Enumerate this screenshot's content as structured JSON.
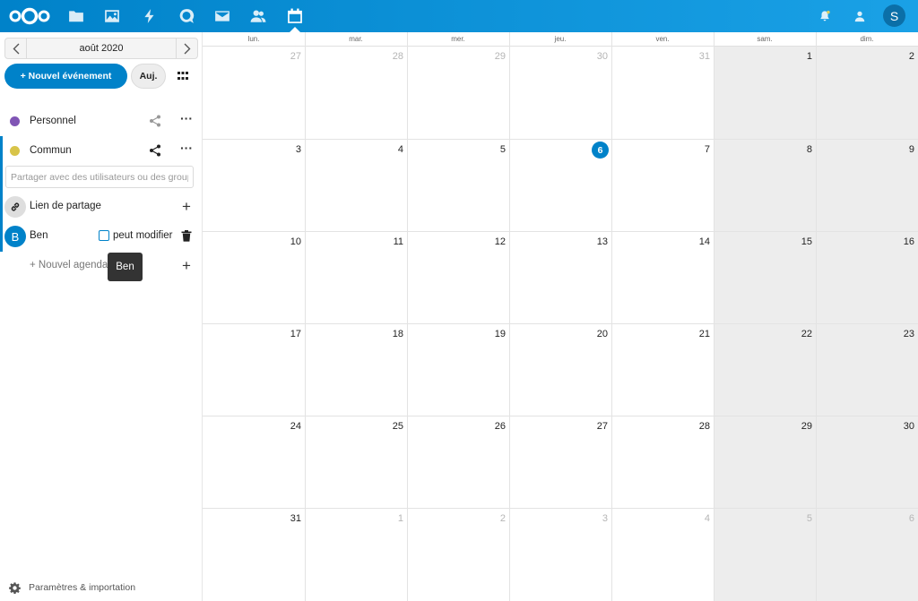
{
  "header": {
    "apps": [
      {
        "name": "files-icon"
      },
      {
        "name": "photos-icon"
      },
      {
        "name": "activity-icon"
      },
      {
        "name": "talk-icon"
      },
      {
        "name": "mail-icon"
      },
      {
        "name": "contacts-icon"
      },
      {
        "name": "calendar-icon",
        "active": true
      }
    ],
    "avatar_initial": "S"
  },
  "sidebar": {
    "month_label": "août 2020",
    "new_event_label": "+ Nouvel événement",
    "today_label": "Auj.",
    "calendars": [
      {
        "name": "Personnel",
        "color": "#8055b5"
      },
      {
        "name": "Commun",
        "color": "#d8c449"
      }
    ],
    "share_placeholder": "Partager avec des utilisateurs ou des groupes",
    "share_link_label": "Lien de partage",
    "sharee": {
      "initial": "B",
      "name": "Ben",
      "permission_label": "peut modifier",
      "can_edit": false
    },
    "new_calendar_label": "+ Nouvel agenda",
    "tooltip": "Ben",
    "settings_label": "Paramètres & importation"
  },
  "calendar": {
    "weekdays": [
      "lun.",
      "mar.",
      "mer.",
      "jeu.",
      "ven.",
      "sam.",
      "dim."
    ],
    "today": 6,
    "weeks": [
      [
        {
          "d": "27",
          "m": true
        },
        {
          "d": "28",
          "m": true
        },
        {
          "d": "29",
          "m": true
        },
        {
          "d": "30",
          "m": true
        },
        {
          "d": "31",
          "m": true
        },
        {
          "d": "1"
        },
        {
          "d": "2"
        }
      ],
      [
        {
          "d": "3"
        },
        {
          "d": "4"
        },
        {
          "d": "5"
        },
        {
          "d": "6"
        },
        {
          "d": "7"
        },
        {
          "d": "8"
        },
        {
          "d": "9"
        }
      ],
      [
        {
          "d": "10"
        },
        {
          "d": "11"
        },
        {
          "d": "12"
        },
        {
          "d": "13"
        },
        {
          "d": "14"
        },
        {
          "d": "15"
        },
        {
          "d": "16"
        }
      ],
      [
        {
          "d": "17"
        },
        {
          "d": "18"
        },
        {
          "d": "19"
        },
        {
          "d": "20"
        },
        {
          "d": "21"
        },
        {
          "d": "22"
        },
        {
          "d": "23"
        }
      ],
      [
        {
          "d": "24"
        },
        {
          "d": "25"
        },
        {
          "d": "26"
        },
        {
          "d": "27"
        },
        {
          "d": "28"
        },
        {
          "d": "29"
        },
        {
          "d": "30"
        }
      ],
      [
        {
          "d": "31"
        },
        {
          "d": "1",
          "m": true
        },
        {
          "d": "2",
          "m": true
        },
        {
          "d": "3",
          "m": true
        },
        {
          "d": "4",
          "m": true
        },
        {
          "d": "5",
          "m": true
        },
        {
          "d": "6",
          "m": true
        }
      ]
    ]
  }
}
